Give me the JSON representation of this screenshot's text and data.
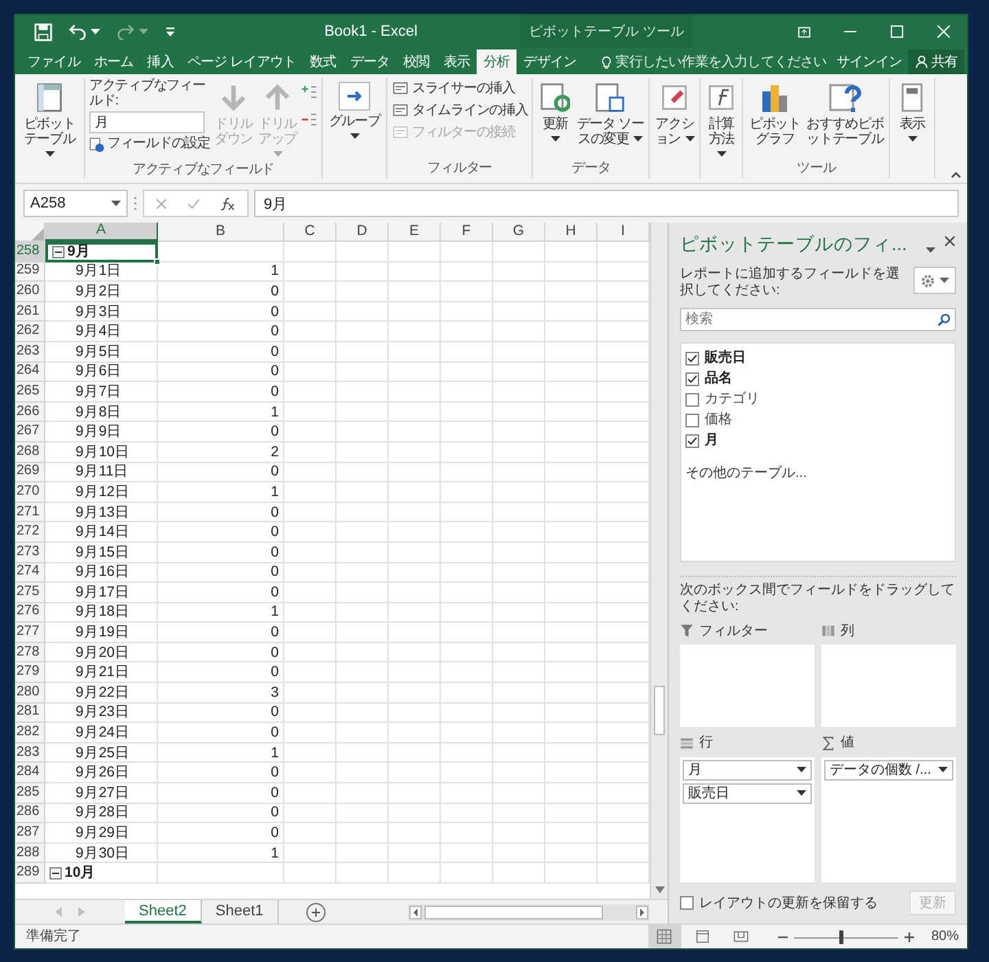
{
  "title_bar": {
    "title": "Book1 - Excel",
    "context_group": "ピボットテーブル ツール"
  },
  "quick_access": [
    {
      "kind": "save",
      "disabled": false
    },
    {
      "kind": "undo",
      "disabled": false
    },
    {
      "kind": "redo",
      "disabled": true
    },
    {
      "kind": "customize",
      "disabled": false
    }
  ],
  "tabs": [
    {
      "label": "ファイル",
      "selected": false
    },
    {
      "label": "ホーム",
      "selected": false
    },
    {
      "label": "挿入",
      "selected": false
    },
    {
      "label": "ページ レイアウト",
      "selected": false
    },
    {
      "label": "数式",
      "selected": false
    },
    {
      "label": "データ",
      "selected": false
    },
    {
      "label": "校閲",
      "selected": false
    },
    {
      "label": "表示",
      "selected": false
    },
    {
      "label": "分析",
      "selected": true
    },
    {
      "label": "デザイン",
      "selected": false
    }
  ],
  "tell_me": "実行したい作業を入力してください",
  "sign_in": "サインイン",
  "share": "共有",
  "ribbon": {
    "pivot_table": {
      "label": "ピボットテーブル",
      "dropdown": true
    },
    "active_field": {
      "label": "アクティブなフィールド:",
      "value": "月",
      "settings": "フィールドの設定",
      "drill_down": {
        "label": "ドリルダウン",
        "disabled": true
      },
      "drill_up": {
        "label": "ドリルアップ",
        "disabled": true
      },
      "group_label": "アクティブなフィールド"
    },
    "group": {
      "label": "グループ",
      "dropdown": true
    },
    "filter": {
      "items": [
        {
          "label": "スライサーの挿入",
          "disabled": false
        },
        {
          "label": "タイムラインの挿入",
          "disabled": false
        },
        {
          "label": "フィルターの接続",
          "disabled": true
        }
      ],
      "group_label": "フィルター"
    },
    "data": {
      "refresh": {
        "label": "更新",
        "dropdown": true
      },
      "source": {
        "label": "データ ソースの変更",
        "dropdown": true
      },
      "group_label": "データ"
    },
    "actions": {
      "label": "アクション",
      "dropdown": true
    },
    "calculations": {
      "label": "計算方法",
      "dropdown": true
    },
    "tools": {
      "chart": {
        "label": "ピボットグラフ"
      },
      "recommended": {
        "label": "おすすめピボットテーブル"
      },
      "group_label": "ツール"
    },
    "show": {
      "label": "表示",
      "dropdown": true
    }
  },
  "name_box": "A258",
  "formula": "9月",
  "columns": [
    {
      "label": "A",
      "selected": true
    },
    {
      "label": "B",
      "selected": false
    },
    {
      "label": "C",
      "selected": false
    },
    {
      "label": "D",
      "selected": false
    },
    {
      "label": "E",
      "selected": false
    },
    {
      "label": "F",
      "selected": false
    },
    {
      "label": "G",
      "selected": false
    },
    {
      "label": "H",
      "selected": false
    },
    {
      "label": "I",
      "selected": false
    }
  ],
  "rows": [
    {
      "number": "258",
      "kind": "group",
      "label": "9月",
      "expanded": true,
      "selected": true
    },
    {
      "number": "259",
      "kind": "item",
      "label": "9月1日",
      "value": "1",
      "selected": false
    },
    {
      "number": "260",
      "kind": "item",
      "label": "9月2日",
      "value": "0",
      "selected": false
    },
    {
      "number": "261",
      "kind": "item",
      "label": "9月3日",
      "value": "0",
      "selected": false
    },
    {
      "number": "262",
      "kind": "item",
      "label": "9月4日",
      "value": "0",
      "selected": false
    },
    {
      "number": "263",
      "kind": "item",
      "label": "9月5日",
      "value": "0",
      "selected": false
    },
    {
      "number": "264",
      "kind": "item",
      "label": "9月6日",
      "value": "0",
      "selected": false
    },
    {
      "number": "265",
      "kind": "item",
      "label": "9月7日",
      "value": "0",
      "selected": false
    },
    {
      "number": "266",
      "kind": "item",
      "label": "9月8日",
      "value": "1",
      "selected": false
    },
    {
      "number": "267",
      "kind": "item",
      "label": "9月9日",
      "value": "0",
      "selected": false
    },
    {
      "number": "268",
      "kind": "item",
      "label": "9月10日",
      "value": "2",
      "selected": false
    },
    {
      "number": "269",
      "kind": "item",
      "label": "9月11日",
      "value": "0",
      "selected": false
    },
    {
      "number": "270",
      "kind": "item",
      "label": "9月12日",
      "value": "1",
      "selected": false
    },
    {
      "number": "271",
      "kind": "item",
      "label": "9月13日",
      "value": "0",
      "selected": false
    },
    {
      "number": "272",
      "kind": "item",
      "label": "9月14日",
      "value": "0",
      "selected": false
    },
    {
      "number": "273",
      "kind": "item",
      "label": "9月15日",
      "value": "0",
      "selected": false
    },
    {
      "number": "274",
      "kind": "item",
      "label": "9月16日",
      "value": "0",
      "selected": false
    },
    {
      "number": "275",
      "kind": "item",
      "label": "9月17日",
      "value": "0",
      "selected": false
    },
    {
      "number": "276",
      "kind": "item",
      "label": "9月18日",
      "value": "1",
      "selected": false
    },
    {
      "number": "277",
      "kind": "item",
      "label": "9月19日",
      "value": "0",
      "selected": false
    },
    {
      "number": "278",
      "kind": "item",
      "label": "9月20日",
      "value": "0",
      "selected": false
    },
    {
      "number": "279",
      "kind": "item",
      "label": "9月21日",
      "value": "0",
      "selected": false
    },
    {
      "number": "280",
      "kind": "item",
      "label": "9月22日",
      "value": "3",
      "selected": false
    },
    {
      "number": "281",
      "kind": "item",
      "label": "9月23日",
      "value": "0",
      "selected": false
    },
    {
      "number": "282",
      "kind": "item",
      "label": "9月24日",
      "value": "0",
      "selected": false
    },
    {
      "number": "283",
      "kind": "item",
      "label": "9月25日",
      "value": "1",
      "selected": false
    },
    {
      "number": "284",
      "kind": "item",
      "label": "9月26日",
      "value": "0",
      "selected": false
    },
    {
      "number": "285",
      "kind": "item",
      "label": "9月27日",
      "value": "0",
      "selected": false
    },
    {
      "number": "286",
      "kind": "item",
      "label": "9月28日",
      "value": "0",
      "selected": false
    },
    {
      "number": "287",
      "kind": "item",
      "label": "9月29日",
      "value": "0",
      "selected": false
    },
    {
      "number": "288",
      "kind": "item",
      "label": "9月30日",
      "value": "1",
      "selected": false
    },
    {
      "number": "289",
      "kind": "group",
      "label": "10月",
      "expanded": true,
      "selected": false
    }
  ],
  "sheets": [
    {
      "label": "Sheet2",
      "selected": true
    },
    {
      "label": "Sheet1",
      "selected": false
    }
  ],
  "pivot_pane": {
    "title": "ピボットテーブルのフィ...",
    "instruction": "レポートに追加するフィールドを選択してください:",
    "search": {
      "placeholder": "検索"
    },
    "fields": [
      {
        "label": "販売日",
        "checked": true
      },
      {
        "label": "品名",
        "checked": true
      },
      {
        "label": "カテゴリ",
        "checked": false
      },
      {
        "label": "価格",
        "checked": false
      },
      {
        "label": "月",
        "checked": true
      }
    ],
    "more_tables": "その他のテーブル...",
    "drag_hint": "次のボックス間でフィールドをドラッグしてください:",
    "areas": [
      {
        "kind": "filters",
        "label": "フィルター"
      },
      {
        "kind": "columns",
        "label": "列"
      },
      {
        "kind": "rows",
        "label": "行",
        "items": [
          "月",
          "販売日"
        ]
      },
      {
        "kind": "values",
        "label": "値",
        "items": [
          "データの個数 /..."
        ]
      }
    ],
    "defer": {
      "label": "レイアウトの更新を保留する",
      "checked": false
    },
    "update": {
      "label": "更新",
      "disabled": true
    }
  },
  "status_bar": {
    "status": "準備完了",
    "views": [
      {
        "kind": "normal",
        "selected": true
      },
      {
        "kind": "page_layout",
        "selected": false
      },
      {
        "kind": "page_break",
        "selected": false
      }
    ],
    "zoom": {
      "level": 0.45,
      "reading": "80%"
    }
  }
}
